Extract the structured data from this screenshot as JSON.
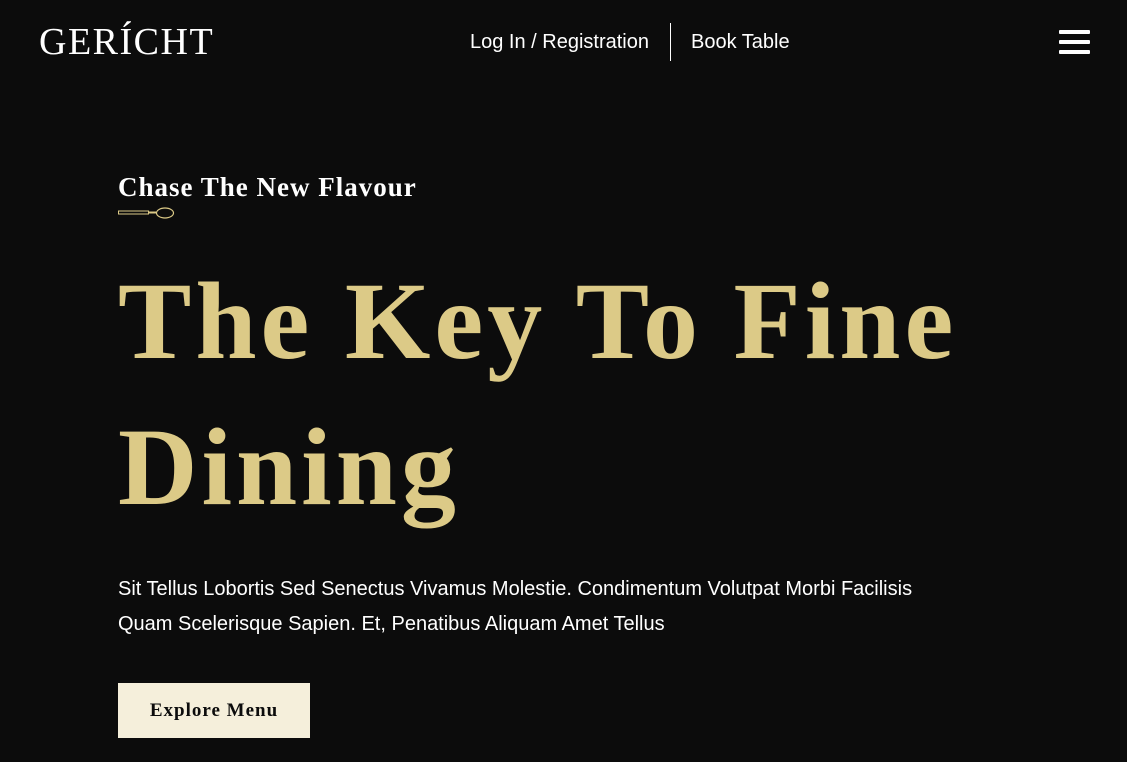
{
  "brand": {
    "logo_text": "GERÍCHT"
  },
  "nav": {
    "login_label": "Log In / Registration",
    "book_label": "Book Table"
  },
  "hero": {
    "subtitle": "Chase The New Flavour",
    "headline_line1": "The Key To Fine",
    "headline_line2": "Dining",
    "description_line1": "Sit Tellus Lobortis Sed Senectus Vivamus Molestie. Condimentum Volutpat Morbi Facilisis",
    "description_line2": "Quam Scelerisque Sapien. Et, Penatibus Aliquam Amet Tellus",
    "cta_label": "Explore Menu"
  },
  "colors": {
    "background": "#0c0c0c",
    "gold": "#dcca87",
    "cream": "#f5efdb",
    "text": "#ffffff"
  },
  "icons": {
    "menu": "hamburger-menu-icon",
    "divider": "spoon-icon"
  }
}
